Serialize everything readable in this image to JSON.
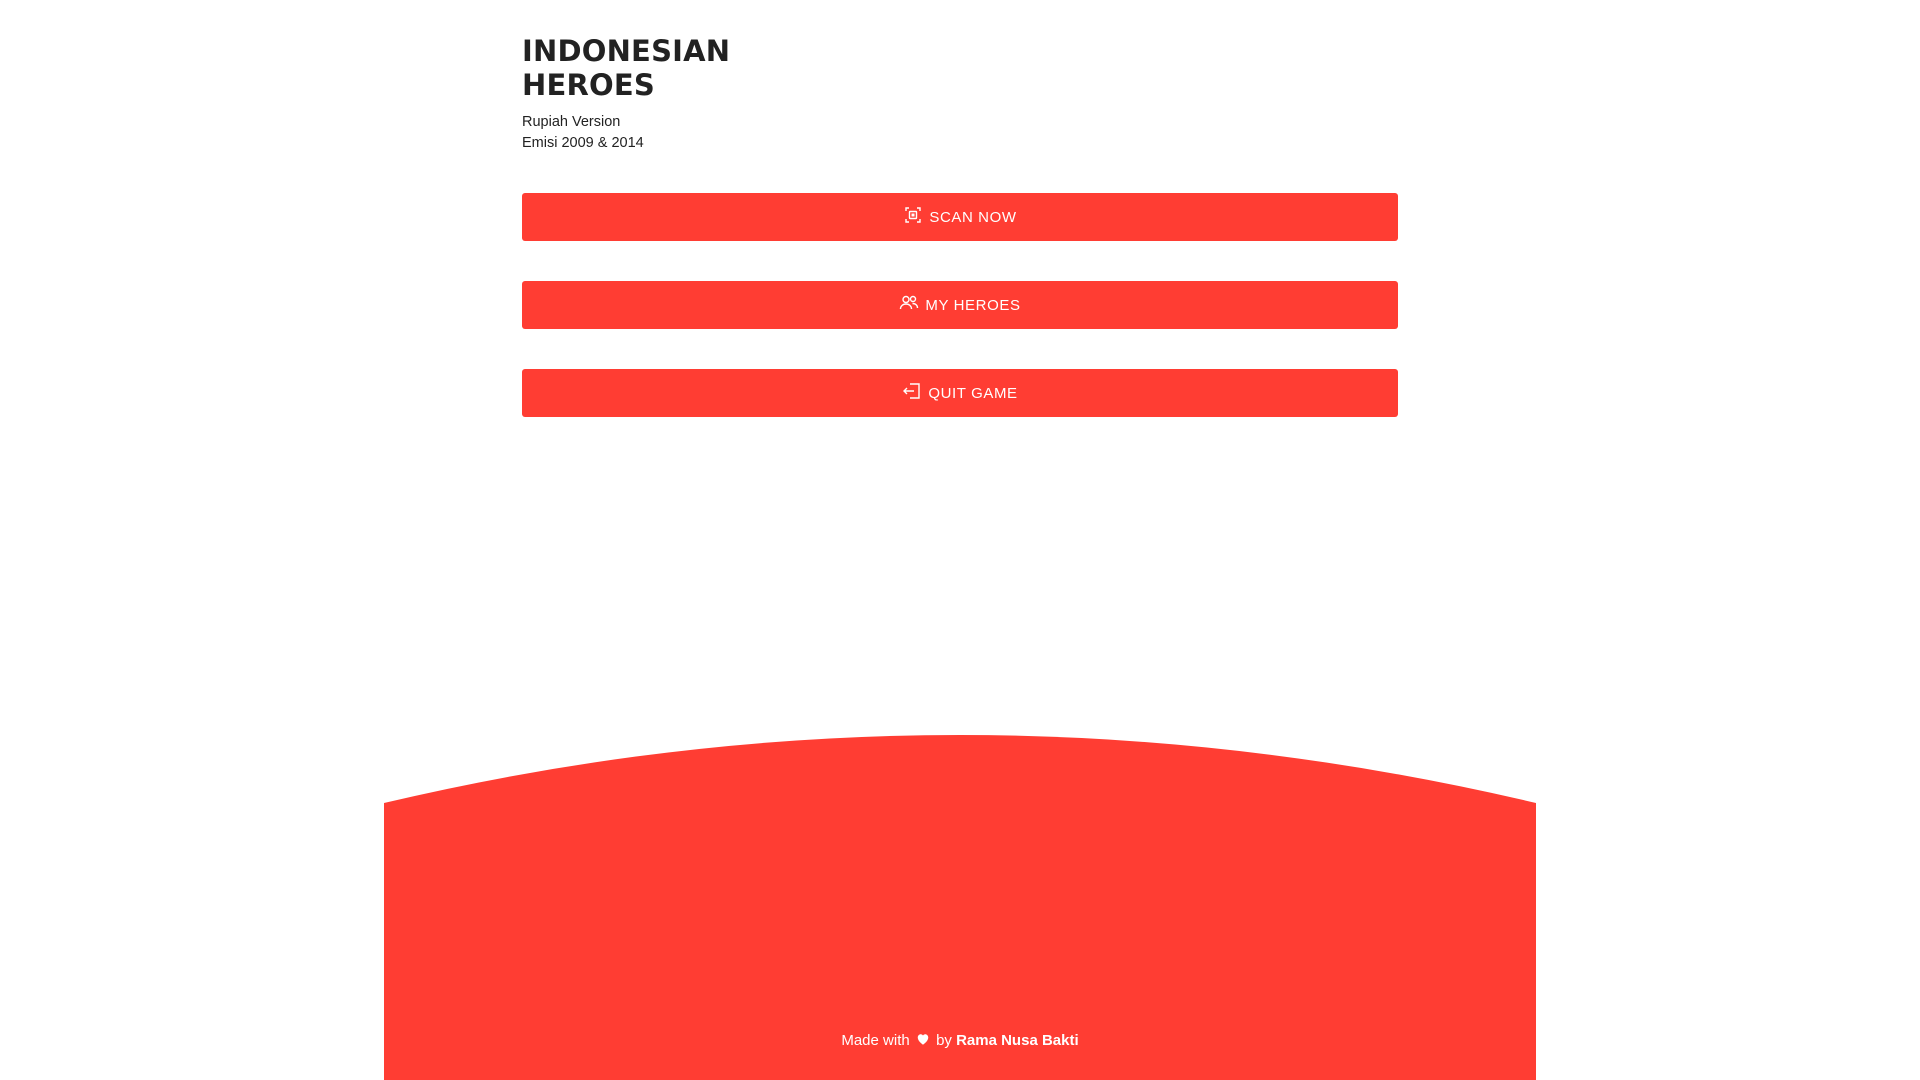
{
  "header": {
    "title_line1": "INDONESIAN",
    "title_line2": "HEROES",
    "subtitle_line1": "Rupiah Version",
    "subtitle_line2": "Emisi 2009 & 2014"
  },
  "menu": {
    "scan_label": "SCAN NOW",
    "heroes_label": "MY HEROES",
    "quit_label": "QUIT GAME"
  },
  "footer": {
    "made_with": "Made with",
    "by": "by",
    "author": "Rama Nusa Bakti"
  },
  "colors": {
    "accent": "#ff3d33",
    "text": "#222222",
    "background": "#ffffff"
  },
  "icons": {
    "scan": "scan-icon",
    "heroes": "users-icon",
    "quit": "exit-icon",
    "heart": "heart-icon"
  }
}
